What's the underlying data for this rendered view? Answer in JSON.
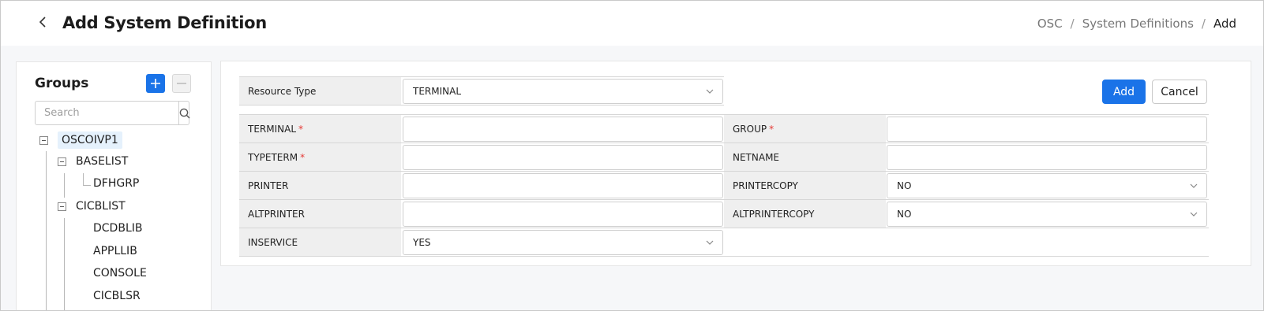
{
  "header": {
    "title": "Add System Definition",
    "breadcrumb": [
      "OSC",
      "System Definitions",
      "Add"
    ]
  },
  "groups": {
    "title": "Groups",
    "search_placeholder": "Search",
    "tree": {
      "root": "OSCOIVP1",
      "baselist": {
        "label": "BASELIST",
        "children": [
          "DFHGRP"
        ]
      },
      "cicblist": {
        "label": "CICBLIST",
        "children": [
          "DCDBLIB",
          "APPLLIB",
          "CONSOLE",
          "CICBLSR"
        ]
      }
    }
  },
  "form": {
    "resource_type_label": "Resource Type",
    "resource_type_value": "TERMINAL",
    "add_label": "Add",
    "cancel_label": "Cancel",
    "fields": {
      "terminal": {
        "label": "TERMINAL",
        "required": "*",
        "value": ""
      },
      "group": {
        "label": "GROUP",
        "required": "*",
        "value": ""
      },
      "typeterm": {
        "label": "TYPETERM",
        "required": "*",
        "value": ""
      },
      "netname": {
        "label": "NETNAME",
        "value": ""
      },
      "printer": {
        "label": "PRINTER",
        "value": ""
      },
      "printercopy": {
        "label": "PRINTERCOPY",
        "value": "NO"
      },
      "altprinter": {
        "label": "ALTPRINTER",
        "value": ""
      },
      "altprintercopy": {
        "label": "ALTPRINTERCOPY",
        "value": "NO"
      },
      "inservice": {
        "label": "INSERVICE",
        "value": "YES"
      }
    }
  },
  "colors": {
    "accent": "#1a73e8",
    "required": "#e53935",
    "label_bg": "#efefef"
  }
}
